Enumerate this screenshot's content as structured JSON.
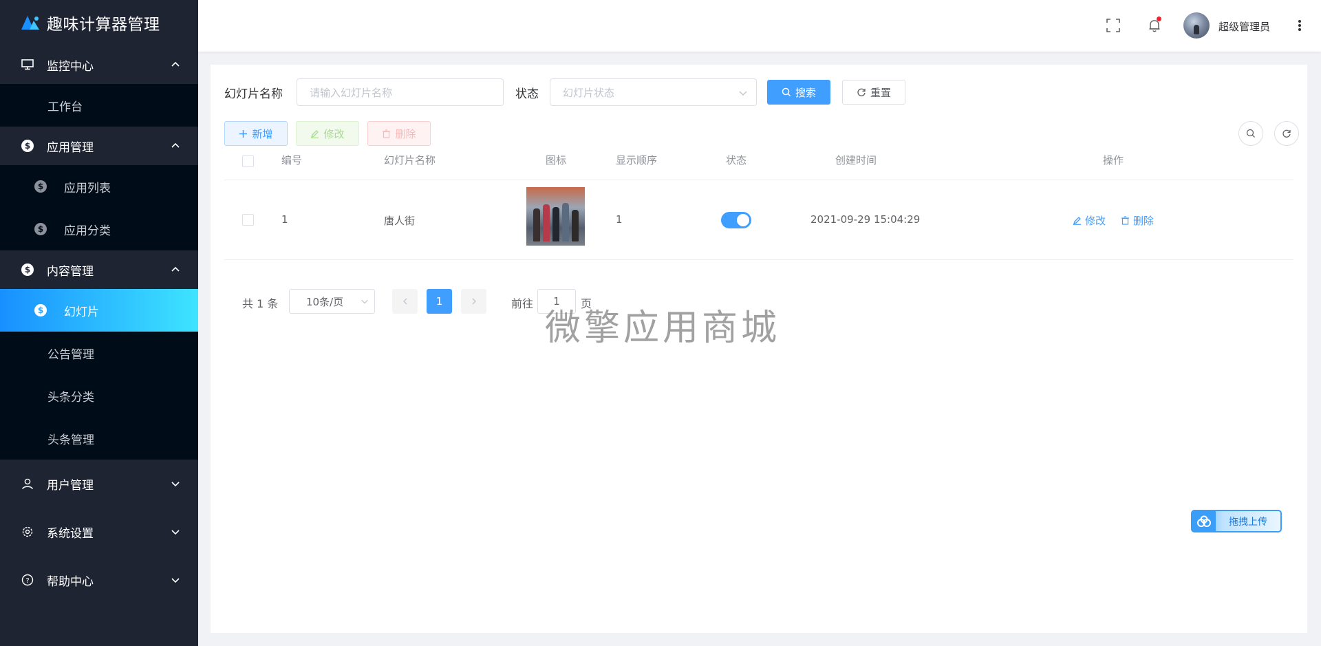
{
  "app": {
    "title": "趣味计算器管理"
  },
  "sidebar": {
    "groups": [
      {
        "label": "监控中心",
        "items": [
          {
            "label": "工作台"
          }
        ]
      },
      {
        "label": "应用管理",
        "items": [
          {
            "label": "应用列表"
          },
          {
            "label": "应用分类"
          }
        ]
      },
      {
        "label": "内容管理",
        "items": [
          {
            "label": "幻灯片"
          },
          {
            "label": "公告管理"
          },
          {
            "label": "头条分类"
          },
          {
            "label": "头条管理"
          }
        ]
      },
      {
        "label": "用户管理"
      },
      {
        "label": "系统设置"
      },
      {
        "label": "帮助中心"
      }
    ]
  },
  "header": {
    "username": "超级管理员"
  },
  "search": {
    "name_label": "幻灯片名称",
    "name_placeholder": "请输入幻灯片名称",
    "status_label": "状态",
    "status_placeholder": "幻灯片状态",
    "search_btn": "搜索",
    "reset_btn": "重置"
  },
  "toolbar": {
    "add": "新增",
    "edit": "修改",
    "delete": "删除"
  },
  "table": {
    "columns": [
      "编号",
      "幻灯片名称",
      "图标",
      "显示顺序",
      "状态",
      "创建时间",
      "操作"
    ],
    "rows": [
      {
        "id": "1",
        "name": "唐人街",
        "order": "1",
        "status": true,
        "created": "2021-09-29 15:04:29",
        "edit": "修改",
        "delete": "删除"
      }
    ]
  },
  "pagination": {
    "total": "共 1 条",
    "page_size": "10条/页",
    "current": "1",
    "goto_label": "前往",
    "goto_value": "1",
    "page_unit": "页"
  },
  "watermark": "微擎应用商城",
  "upload_badge": "拖拽上传",
  "colors": {
    "primary": "#409eff",
    "sidebar_bg": "#1f2433",
    "submenu_bg": "#000c17"
  }
}
